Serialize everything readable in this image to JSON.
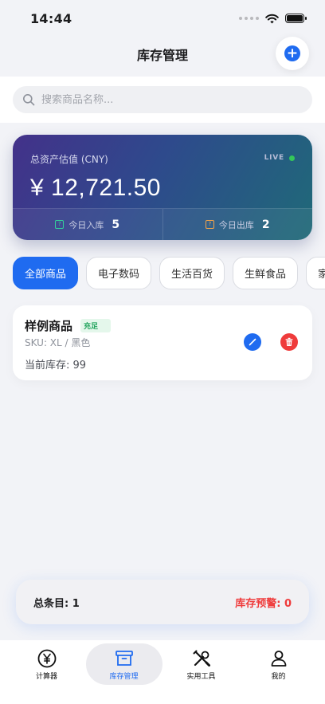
{
  "status_bar": {
    "time": "14:44"
  },
  "header": {
    "title": "库存管理"
  },
  "search": {
    "placeholder": "搜索商品名称..."
  },
  "asset_card": {
    "label": "总资产估值 (CNY)",
    "live_label": "LIVE",
    "value": "¥ 12,721.50",
    "in_label": "今日入库",
    "in_value": "5",
    "out_label": "今日出库",
    "out_value": "2",
    "colors": {
      "live_dot": "#34c759",
      "in_icon": "#33d19b",
      "out_icon": "#f3a34a"
    }
  },
  "categories": [
    {
      "label": "全部商品",
      "active": true
    },
    {
      "label": "电子数码",
      "active": false
    },
    {
      "label": "生活百货",
      "active": false
    },
    {
      "label": "生鲜食品",
      "active": false
    },
    {
      "label": "家用",
      "active": false
    }
  ],
  "products": [
    {
      "name": "样例商品",
      "badge": "充足",
      "sku": "SKU: XL / 黑色",
      "stock": "当前库存: 99"
    }
  ],
  "summary": {
    "total": "总条目: 1",
    "warning": "库存预警: 0"
  },
  "tabs": [
    {
      "label": "计算器",
      "icon": "yen-circle-icon",
      "active": false
    },
    {
      "label": "库存管理",
      "icon": "archive-box-icon",
      "active": true
    },
    {
      "label": "实用工具",
      "icon": "tools-icon",
      "active": false
    },
    {
      "label": "我的",
      "icon": "person-icon",
      "active": false
    }
  ],
  "colors": {
    "accent": "#1f6bf0",
    "danger": "#ef3b3b",
    "success": "#22a45d"
  }
}
